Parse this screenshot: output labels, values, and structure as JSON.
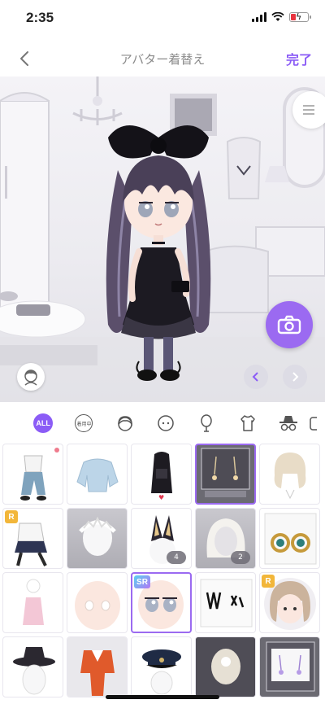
{
  "status_bar": {
    "time": "2:35"
  },
  "nav": {
    "title": "アバター着替え",
    "done_label": "完了"
  },
  "colors": {
    "accent": "#8b5cf6",
    "camera": "#9b6af1"
  },
  "stage": {
    "icons": [
      "menu-icon",
      "camera-icon",
      "face-icon",
      "arrow-left-icon",
      "arrow-right-icon"
    ]
  },
  "categories": [
    {
      "label": "ALL",
      "icon": "all-badge",
      "selected": true
    },
    {
      "label": "着用中",
      "icon": "wearing-icon"
    },
    {
      "icon": "hair-icon"
    },
    {
      "icon": "face-icon"
    },
    {
      "icon": "mirror-icon"
    },
    {
      "icon": "top-icon"
    },
    {
      "icon": "hat-icon"
    },
    {
      "icon": "more-icon"
    }
  ],
  "grid": {
    "items": [
      {
        "name": "jeans-outfit",
        "new": true
      },
      {
        "name": "blue-sweater"
      },
      {
        "name": "black-backpack",
        "favorite": true
      },
      {
        "name": "earring-card",
        "selected": true
      },
      {
        "name": "blonde-short-hair"
      },
      {
        "name": "checker-skirt-outfit",
        "rarity": "R"
      },
      {
        "name": "white-lace-headpiece"
      },
      {
        "name": "fox-ears",
        "count": "4"
      },
      {
        "name": "white-hood",
        "count": "2"
      },
      {
        "name": "gold-earrings"
      },
      {
        "name": "pink-dress"
      },
      {
        "name": "blank-face"
      },
      {
        "name": "gray-eyes",
        "rarity": "SR",
        "selected": true
      },
      {
        "name": "black-lace-choker"
      },
      {
        "name": "girl-face",
        "rarity": "R"
      },
      {
        "name": "black-hat"
      },
      {
        "name": "orange-suit"
      },
      {
        "name": "police-cap"
      },
      {
        "name": "sparkle-light"
      },
      {
        "name": "purple-earring-card"
      }
    ]
  }
}
